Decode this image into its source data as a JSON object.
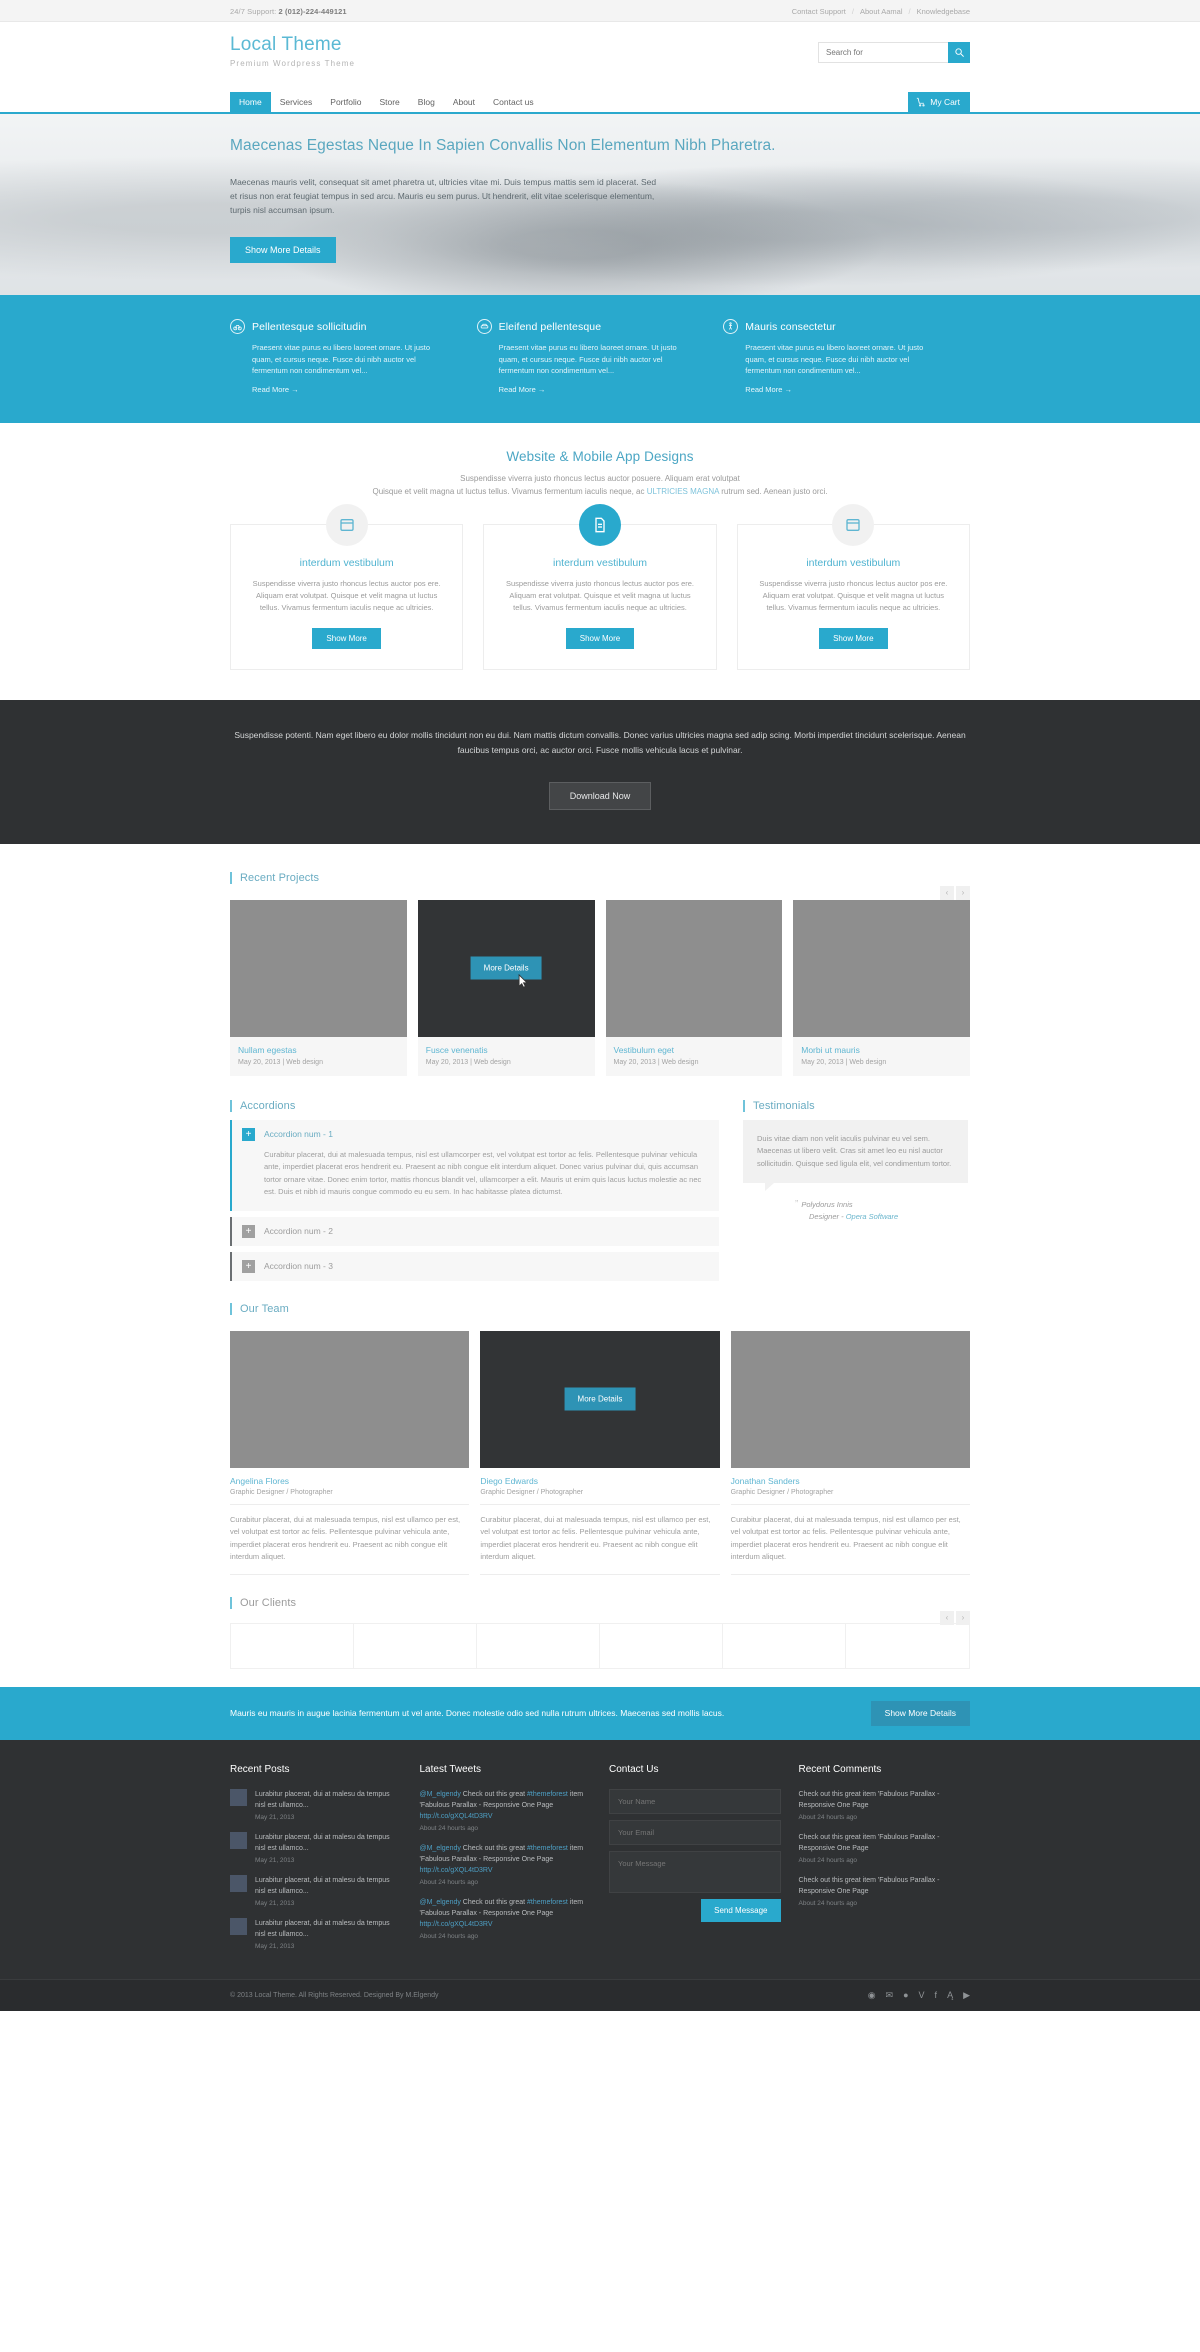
{
  "topbar": {
    "support_label": "24/7 Support:",
    "support_phone": "2 (012)-224-449121",
    "links": [
      "Contact Support",
      "About Aamal",
      "Knowledgebase"
    ],
    "separator": "/"
  },
  "header": {
    "logo": "Local Theme",
    "tagline": "Premium Wordpress Theme",
    "search_placeholder": "Search for",
    "search_value": ""
  },
  "nav": {
    "items": [
      {
        "label": "Home",
        "active": true
      },
      {
        "label": "Services",
        "active": false
      },
      {
        "label": "Portfolio",
        "active": false
      },
      {
        "label": "Store",
        "active": false
      },
      {
        "label": "Blog",
        "active": false
      },
      {
        "label": "About",
        "active": false
      },
      {
        "label": "Contact us",
        "active": false
      }
    ],
    "cart_label": "My Cart"
  },
  "hero": {
    "title": "Maecenas Egestas Neque In Sapien Convallis Non Elementum Nibh Pharetra.",
    "body": "Maecenas mauris velit, consequat sit amet pharetra ut, ultricies vitae mi. Duis tempus mattis sem id placerat. Sed et risus non erat feugiat tempus in sed arcu. Mauris eu sem purus. Ut hendrerit, elit vitae scelerisque elementum, turpis nisl accumsan ipsum.",
    "cta": "Show More Details",
    "prev": "‹",
    "next": "›"
  },
  "features": {
    "items": [
      {
        "icon": "bicycle-icon",
        "title": "Pellentesque sollicitudin",
        "body": "Praesent vitae purus eu libero laoreet ornare. Ut justo quam, et cursus neque. Fusce dui nibh auctor vel fermentum non condimentum vel...",
        "more": "Read More →"
      },
      {
        "icon": "car-icon",
        "title": "Eleifend pellentesque",
        "body": "Praesent vitae purus eu libero laoreet ornare. Ut justo quam, et cursus neque. Fusce dui nibh auctor vel fermentum non condimentum vel...",
        "more": "Read More →"
      },
      {
        "icon": "walk-icon",
        "title": "Mauris consectetur",
        "body": "Praesent vitae purus eu libero laoreet ornare. Ut justo quam, et cursus neque. Fusce dui nibh auctor vel fermentum non condimentum vel...",
        "more": "Read More →"
      }
    ]
  },
  "services": {
    "title": "Website & Mobile App Designs",
    "sub_line1": "Suspendisse viverra justo rhoncus lectus auctor posuere. Aliquam erat volutpat",
    "sub_line2_a": "Quisque et velit magna ut luctus tellus. Vivamus fermentum iaculis neque, ac ",
    "sub_link": "ULTRICIES MAGNA",
    "sub_line2_b": " rutrum sed. Aenean justo orci.",
    "cards": [
      {
        "icon": "window-icon",
        "title": "interdum vestibulum",
        "body": "Suspendisse viverra justo rhoncus lectus auctor pos ere. Aliquam erat volutpat. Quisque et velit magna ut luctus tellus. Vivamus fermentum iaculis neque ac ultricies.",
        "button": "Show More",
        "featured": false
      },
      {
        "icon": "document-icon",
        "title": "interdum vestibulum",
        "body": "Suspendisse viverra justo rhoncus lectus auctor pos ere. Aliquam erat volutpat. Quisque et velit magna ut luctus tellus. Vivamus fermentum iaculis neque ac ultricies.",
        "button": "Show More",
        "featured": true
      },
      {
        "icon": "window-icon",
        "title": "interdum vestibulum",
        "body": "Suspendisse viverra justo rhoncus lectus auctor pos ere. Aliquam erat volutpat. Quisque et velit magna ut luctus tellus. Vivamus fermentum iaculis neque ac ultricies.",
        "button": "Show More",
        "featured": false
      }
    ]
  },
  "download_band": {
    "text": "Suspendisse potenti. Nam eget libero eu dolor mollis tincidunt non eu dui. Nam mattis dictum convallis. Donec varius ultricies magna sed adip scing. Morbi imperdiet tincidunt scelerisque. Aenean faucibus tempus orci, ac auctor orci. Fusce mollis vehicula lacus et pulvinar.",
    "button": "Download Now"
  },
  "projects": {
    "heading": "Recent Projects",
    "prev": "‹",
    "next": "›",
    "overlay_button": "More Details",
    "items": [
      {
        "title": "Nullam egestas",
        "meta": "May 20, 2013 | Web design",
        "hovered": false
      },
      {
        "title": "Fusce venenatis",
        "meta": "May 20, 2013 | Web design",
        "hovered": true
      },
      {
        "title": "Vestibulum eget",
        "meta": "May 20, 2013 | Web design",
        "hovered": false
      },
      {
        "title": "Morbi ut mauris",
        "meta": "May 20, 2013 | Web design",
        "hovered": false
      }
    ]
  },
  "accordions": {
    "heading": "Accordions",
    "items": [
      {
        "title": "Accordion num - 1",
        "open": true,
        "body": "Curabitur placerat, dui at malesuada tempus, nisl est ullamcorper est, vel volutpat est tortor ac felis. Pellentesque pulvinar vehicula ante, imperdiet placerat eros hendrerit eu. Praesent ac nibh congue elit interdum aliquet. Donec varius pulvinar dui, quis accumsan tortor ornare vitae. Donec enim tortor, mattis rhoncus blandit vel, ullamcorper a elit. Mauris ut enim quis lacus luctus molestie ac nec est. Duis et nibh id mauris congue commodo eu eu sem. In hac habitasse platea dictumst."
      },
      {
        "title": "Accordion num - 2",
        "open": false,
        "body": ""
      },
      {
        "title": "Accordion num - 3",
        "open": false,
        "body": ""
      }
    ],
    "plus": "+"
  },
  "testimonials": {
    "heading": "Testimonials",
    "quote": "Duis vitae diam non velit iaculis pulvinar eu vel sem. Maecenas ut libero velit. Cras sit amet leo eu nisl auctor sollicitudin. Quisque sed ligula elit, vel condimentum tortor.",
    "author": "Polydorus Innis",
    "role_prefix": "Designer - ",
    "company": "Opera Software",
    "quote_mark": "”"
  },
  "team": {
    "heading": "Our Team",
    "overlay_button": "More Details",
    "members": [
      {
        "name": "Angelina Flores",
        "role": "Graphic Designer / Photographer",
        "bio": "Curabitur placerat, dui at malesuada tempus, nisl est ullamco per est, vel volutpat est tortor ac felis. Pellentesque pulvinar vehicula ante, imperdiet placerat eros hendrerit eu. Praesent ac nibh congue elit interdum aliquet.",
        "hovered": false
      },
      {
        "name": "Diego Edwards",
        "role": "Graphic Designer / Photographer",
        "bio": "Curabitur placerat, dui at malesuada tempus, nisl est ullamco per est, vel volutpat est tortor ac felis. Pellentesque pulvinar vehicula ante, imperdiet placerat eros hendrerit eu. Praesent ac nibh congue elit interdum aliquet.",
        "hovered": true
      },
      {
        "name": "Jonathan Sanders",
        "role": "Graphic Designer / Photographer",
        "bio": "Curabitur placerat, dui at malesuada tempus, nisl est ullamco per est, vel volutpat est tortor ac felis. Pellentesque pulvinar vehicula ante, imperdiet placerat eros hendrerit eu. Praesent ac nibh congue elit interdum aliquet.",
        "hovered": false
      }
    ]
  },
  "clients": {
    "heading": "Our Clients",
    "prev": "‹",
    "next": "›",
    "cells": 6
  },
  "blue_cta": {
    "text": "Mauris eu mauris in augue lacinia fermentum ut vel ante. Donec molestie odio sed nulla rutrum ultrices. Maecenas sed mollis lacus.",
    "button": "Show More Details"
  },
  "footer": {
    "recent_posts": {
      "heading": "Recent Posts",
      "items": [
        {
          "text": "Lurabitur placerat, dui at malesu da tempus nisl est ullamco...",
          "date": "May 21, 2013"
        },
        {
          "text": "Lurabitur placerat, dui at malesu da tempus nisl est ullamco...",
          "date": "May 21, 2013"
        },
        {
          "text": "Lurabitur placerat, dui at malesu da tempus nisl est ullamco...",
          "date": "May 21, 2013"
        },
        {
          "text": "Lurabitur placerat, dui at malesu da tempus nisl est ullamco...",
          "date": "May 21, 2013"
        }
      ]
    },
    "latest_tweets": {
      "heading": "Latest Tweets",
      "items": [
        {
          "handle": "@M_elgendy",
          "mid": " Check out this great ",
          "hashtag": "#themeforest",
          "rest": " item 'Fabulous Parallax - Responsive One Page ",
          "link": "http://t.co/gXQL4tD3RV",
          "date": "About 24 hourts ago"
        },
        {
          "handle": "@M_elgendy",
          "mid": " Check out this great ",
          "hashtag": "#themeforest",
          "rest": " item 'Fabulous Parallax - Responsive One Page ",
          "link": "http://t.co/gXQL4tD3RV",
          "date": "About 24 hourts ago"
        },
        {
          "handle": "@M_elgendy",
          "mid": " Check out this great ",
          "hashtag": "#themeforest",
          "rest": " item 'Fabulous Parallax - Responsive One Page ",
          "link": "http://t.co/gXQL4tD3RV",
          "date": "About 24 hourts ago"
        }
      ]
    },
    "contact": {
      "heading": "Contact Us",
      "name_placeholder": "Your Name",
      "email_placeholder": "Your Email",
      "message_placeholder": "Your Message",
      "send_label": "Send Message"
    },
    "recent_comments": {
      "heading": "Recent Comments",
      "items": [
        {
          "text": "Check out this great item 'Fabulous Parallax - Responsive One Page",
          "date": "About 24 hourts ago"
        },
        {
          "text": "Check out this great item 'Fabulous Parallax - Responsive One Page",
          "date": "About 24 hourts ago"
        },
        {
          "text": "Check out this great item 'Fabulous Parallax - Responsive One Page",
          "date": "About 24 hourts ago"
        }
      ]
    }
  },
  "bottombar": {
    "copyright": "© 2013 Local Theme. All Rights Reserved. Designed By M.Elgendy",
    "socials": [
      "rss-icon",
      "twitter-icon",
      "dribbble-icon",
      "vimeo-icon",
      "facebook-icon",
      "behance-icon",
      "youtube-icon"
    ],
    "social_glyphs": [
      "◉",
      "✉",
      "●",
      "V",
      "f",
      "Ą",
      "▶"
    ]
  },
  "colors": {
    "accent": "#29a9cd",
    "accent_dark": "#2e93b5",
    "dark": "#2f3133",
    "heading": "#6aacc2"
  }
}
